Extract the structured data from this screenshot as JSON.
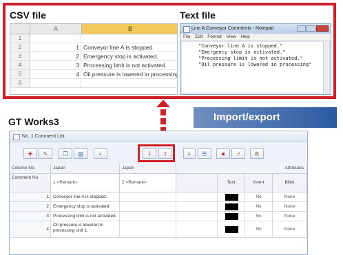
{
  "csv": {
    "label": "CSV file",
    "col_a": "A",
    "col_b": "B",
    "rows": [
      {
        "num": "1",
        "a": "",
        "b": ""
      },
      {
        "num": "2",
        "a": "1",
        "b": "Conveyor line A is stopped."
      },
      {
        "num": "3",
        "a": "2",
        "b": "Emergency stop is activated."
      },
      {
        "num": "4",
        "a": "3",
        "b": "Processing limit is not activated."
      },
      {
        "num": "5",
        "a": "4",
        "b": "Oil pressure is lowered in processing"
      },
      {
        "num": "6",
        "a": "",
        "b": ""
      }
    ]
  },
  "text_file": {
    "label": "Text file",
    "window_title": "Line A Conveyor Comments - Notepad",
    "menu": "File Edit Format View Help",
    "lines": [
      "\"Conveyor line A is stopped.\"",
      "\"Emergency stop is activated.\"",
      "\"Processing limit is not activated.\"",
      "\"Oil pressure is lowered in processing\""
    ]
  },
  "import_export_label": "Import/export",
  "gt_works": {
    "label": "GT Works3",
    "window_title": "No. 1  Comment List",
    "headers": {
      "column_no": "Column No.",
      "japan_1": "Japan",
      "japan_2": "Japan",
      "attributes": "Attributes",
      "comment_no": "Comment No.",
      "remark_1": "1 <Remark>",
      "remark_2": "2 <Remark>",
      "text": "Text",
      "invert": "Invert",
      "blink": "Blink"
    },
    "rows": [
      {
        "no": "1",
        "comment": "Conveyor line A is stopped.",
        "invert": "No",
        "blink": "None"
      },
      {
        "no": "2",
        "comment": "Emergency stop is activated.",
        "invert": "No",
        "blink": "None"
      },
      {
        "no": "3",
        "comment": "Processing limit is not activated.",
        "invert": "No",
        "blink": "None"
      },
      {
        "no": "4",
        "comment": "Oil pressure is lowered in processing unit 1.",
        "invert": "No",
        "blink": "None"
      }
    ]
  },
  "colors": {
    "highlight_red": "#cf1f29",
    "import_export_blue": "#2b5aa2",
    "spreadsheet_selected_column": "#f3c95a"
  }
}
